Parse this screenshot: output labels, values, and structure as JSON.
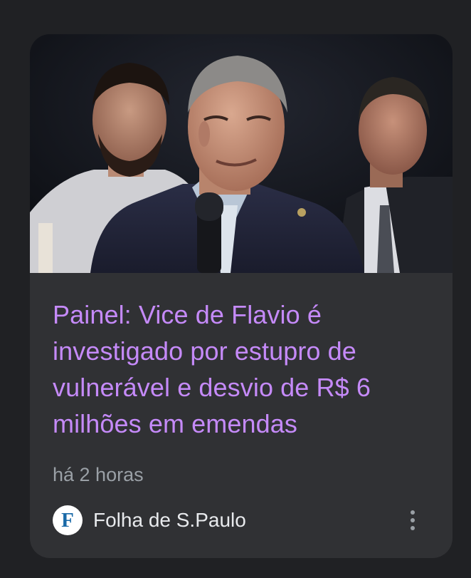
{
  "article": {
    "headline": "Painel: Vice de Flavio é investigado por estupro de vulnerável e desvio de R$ 6 milhões em emendas",
    "timestamp": "há 2 horas",
    "image": {
      "description": "news-photo-man-speaking-into-microphone"
    }
  },
  "source": {
    "name": "Folha de S.Paulo",
    "logo_letter": "F"
  },
  "menu": {
    "icon": "more-vert-icon"
  },
  "colors": {
    "background": "#202124",
    "card": "#303134",
    "headline": "#c58af9",
    "timestamp": "#9aa0a6",
    "source_text": "#e8eaed",
    "logo_accent": "#1a6aa8"
  }
}
